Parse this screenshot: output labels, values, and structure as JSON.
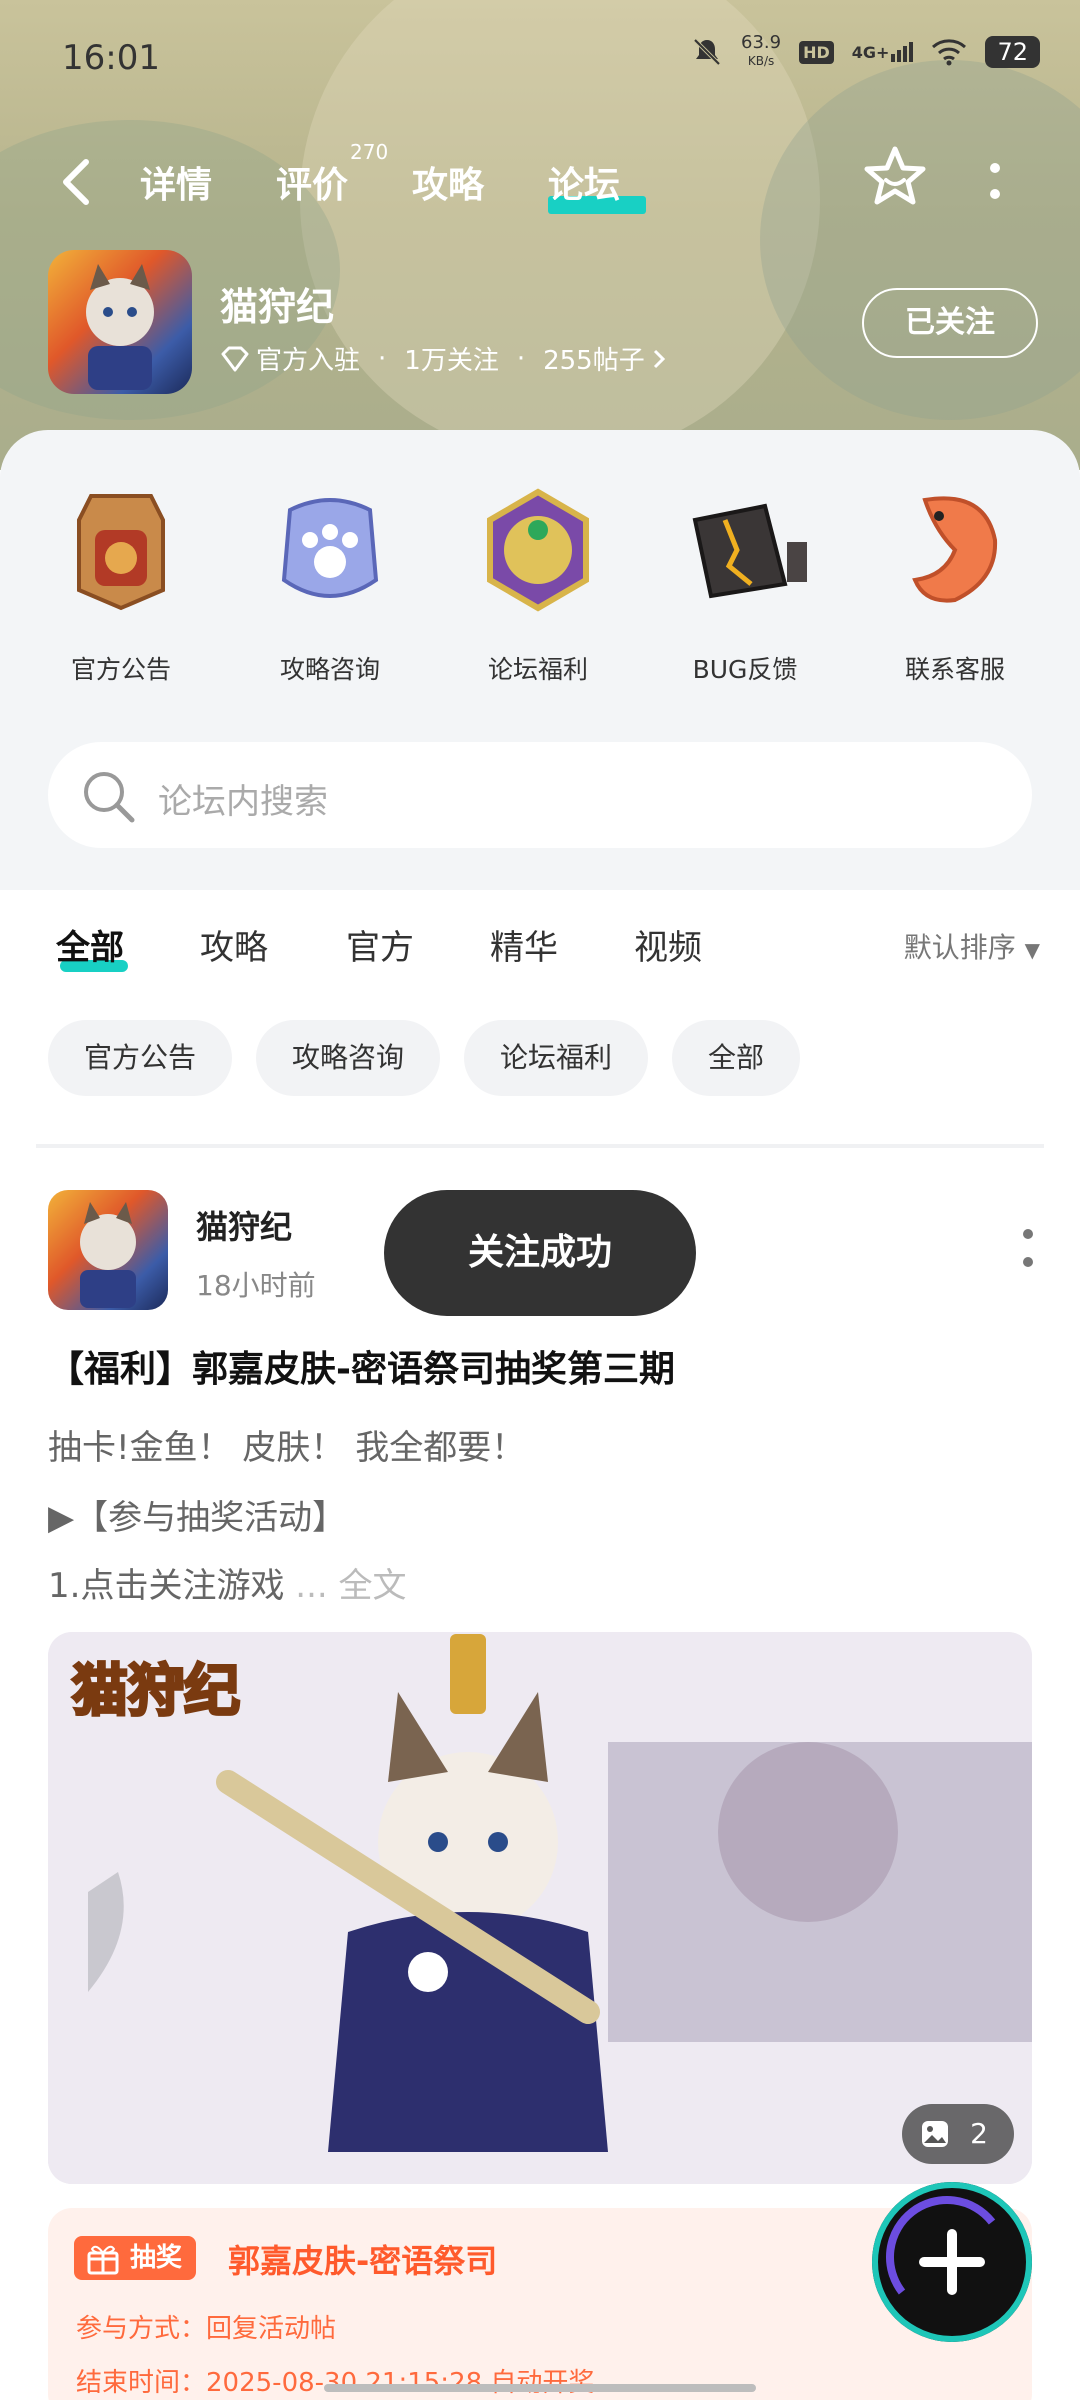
{
  "status": {
    "time": "16:01",
    "net_speed": "63.9",
    "net_unit": "KB/s",
    "hd": "HD",
    "signal": "4G+",
    "battery": "72"
  },
  "nav": {
    "tabs": [
      "详情",
      "评价",
      "攻略",
      "论坛"
    ],
    "review_count": "270",
    "active_tab": "论坛"
  },
  "game": {
    "name": "猫狩纪",
    "meta": [
      "官方入驻",
      "1万关注",
      "255帖子"
    ],
    "follow_label": "已关注"
  },
  "quick_entries": [
    {
      "label": "官方公告",
      "icon": "announcement-badge-icon"
    },
    {
      "label": "攻略咨询",
      "icon": "paw-shield-icon"
    },
    {
      "label": "论坛福利",
      "icon": "gem-medallion-icon"
    },
    {
      "label": "BUG反馈",
      "icon": "cracked-box-icon"
    },
    {
      "label": "联系客服",
      "icon": "koi-fish-icon"
    }
  ],
  "search": {
    "placeholder": "论坛内搜索"
  },
  "filter": {
    "tabs": [
      "全部",
      "攻略",
      "官方",
      "精华",
      "视频"
    ],
    "active": "全部",
    "sort_label": "默认排序"
  },
  "chips": [
    "官方公告",
    "攻略咨询",
    "论坛福利",
    "全部"
  ],
  "post": {
    "author": "猫狩纪",
    "time": "18小时前",
    "title": "【福利】郭嘉皮肤-密语祭司抽奖第三期",
    "lines": [
      "抽卡!金鱼！ 皮肤！ 我全都要！",
      "▶【参与抽奖活动】",
      "1.点击关注游戏"
    ],
    "ellipsis": "...",
    "more_label": "全文",
    "image_logo": "猫狩纪",
    "image_count": "2",
    "lottery": {
      "tag": "抽奖",
      "name": "郭嘉皮肤-密语祭司",
      "method_label": "参与方式：",
      "method": "回复活动帖",
      "end_label": "结束时间：",
      "end_time": "2025-08-30 21:15:28",
      "end_note": "自动开奖"
    }
  },
  "toast": "关注成功",
  "colors": {
    "accent": "#18d0c4",
    "orange": "#ff6a3d",
    "toast_bg": "#333333"
  }
}
